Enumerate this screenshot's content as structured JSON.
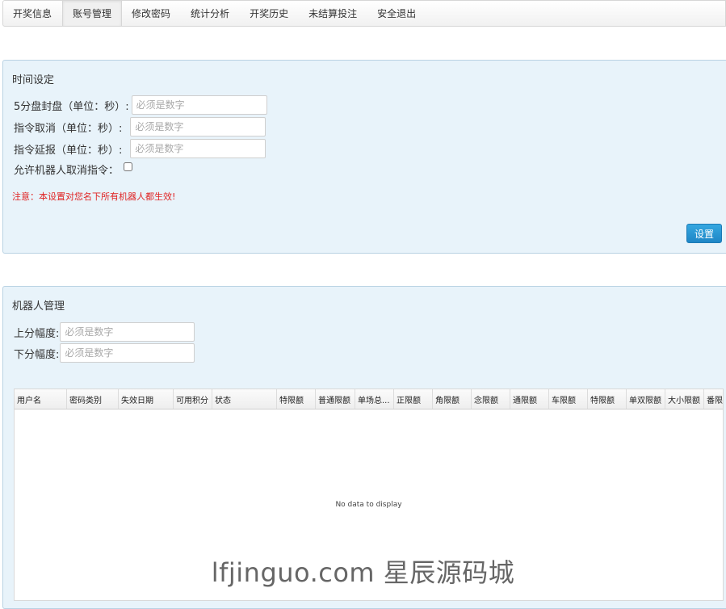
{
  "nav": {
    "items": [
      "开奖信息",
      "账号管理",
      "修改密码",
      "统计分析",
      "开奖历史",
      "未结算投注",
      "安全退出"
    ],
    "active_index": 1
  },
  "time_panel": {
    "title": "时间设定",
    "fields": [
      {
        "label": "5分盘封盘（单位：秒）:",
        "value": "",
        "placeholder": "必须是数字"
      },
      {
        "label": "指令取消（单位：秒）:",
        "value": "",
        "placeholder": "必须是数字"
      },
      {
        "label": "指令延报（单位：秒）:",
        "value": "",
        "placeholder": "必须是数字"
      }
    ],
    "checkbox_label": "允许机器人取消指令：",
    "checkbox_checked": false,
    "note": "注意：本设置对您名下所有机器人都生效!",
    "submit_label": "设置"
  },
  "robot_panel": {
    "title": "机器人管理",
    "fields": [
      {
        "label": "上分幅度:",
        "value": "",
        "placeholder": "必须是数字"
      },
      {
        "label": "下分幅度:",
        "value": "",
        "placeholder": "必须是数字"
      }
    ],
    "table": {
      "columns": [
        "用户名",
        "密码类别",
        "失效日期",
        "可用积分",
        "状态",
        "特限额",
        "普通限额",
        "单场总...",
        "正限额",
        "角限额",
        "念限额",
        "通限额",
        "车限额",
        "特限额",
        "单双限额",
        "大小限额",
        "番限额"
      ],
      "rows": [],
      "empty_text": "No data to display"
    }
  },
  "watermark": "lfjinguo.com 星辰源码城",
  "colors": {
    "panel_bg": "#e8f3fa",
    "panel_border": "#b9d2e3",
    "note_red": "#e02424",
    "button_blue": "#2a97d6"
  }
}
